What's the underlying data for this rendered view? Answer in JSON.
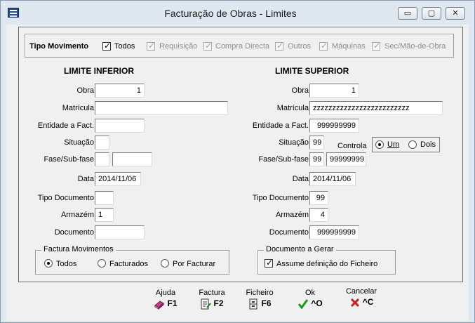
{
  "window": {
    "title": "Facturação de Obras - Limites",
    "controls": {
      "minimize": "▭",
      "restore": "▢",
      "close": "✕"
    }
  },
  "tipo_movimento": {
    "label": "Tipo Movimento",
    "options": [
      {
        "label": "Todos",
        "checked": true,
        "enabled": true
      },
      {
        "label": "Requisição",
        "checked": true,
        "enabled": false
      },
      {
        "label": "Compra Directa",
        "checked": true,
        "enabled": false
      },
      {
        "label": "Outros",
        "checked": true,
        "enabled": false
      },
      {
        "label": "Máquinas",
        "checked": true,
        "enabled": false
      },
      {
        "label": "Sec/Mão-de-Obra",
        "checked": true,
        "enabled": false
      }
    ]
  },
  "limite_inferior": {
    "heading": "LIMITE INFERIOR",
    "obra_label": "Obra",
    "obra_value": "1",
    "matricula_label": "Matrícula",
    "matricula_value": "",
    "entidade_label": "Entidade a Fact.",
    "entidade_value": "",
    "situacao_label": "Situação",
    "situacao_value": "",
    "fase_label": "Fase/Sub-fase",
    "fase_value": "",
    "subfase_value": "",
    "data_label": "Data",
    "data_value": "2014/11/06",
    "tipo_doc_label": "Tipo Documento",
    "tipo_doc_value": "",
    "armazem_label": "Armazém",
    "armazem_value": "1",
    "documento_label": "Documento",
    "documento_value": ""
  },
  "limite_superior": {
    "heading": "LIMITE SUPERIOR",
    "obra_label": "Obra",
    "obra_value": "1",
    "matricula_label": "Matrícula",
    "matricula_value": "zzzzzzzzzzzzzzzzzzzzzzzzz",
    "entidade_label": "Entidade a Fact.",
    "entidade_value": "999999999",
    "situacao_label": "Situação",
    "situacao_value": "99",
    "controla_label": "Controla",
    "controla_options": [
      {
        "label": "Um",
        "selected": true
      },
      {
        "label": "Dois",
        "selected": false
      }
    ],
    "fase_label": "Fase/Sub-fase",
    "fase_value": "99",
    "subfase_value": "99999999",
    "data_label": "Data",
    "data_value": "2014/11/06",
    "tipo_doc_label": "Tipo Documento",
    "tipo_doc_value": "99",
    "armazem_label": "Armazém",
    "armazem_value": "4",
    "documento_label": "Documento",
    "documento_value": "999999999"
  },
  "factura_movimentos": {
    "title": "Factura Movimentos",
    "options": [
      {
        "label": "Todos",
        "selected": true
      },
      {
        "label": "Facturados",
        "selected": false
      },
      {
        "label": "Por Facturar",
        "selected": false
      }
    ]
  },
  "documento_gerar": {
    "title": "Documento a Gerar",
    "checkbox_label": "Assume definição do Ficheiro",
    "checked": true
  },
  "function_keys": [
    {
      "label": "Ajuda",
      "key": "F1",
      "icon": "book-icon"
    },
    {
      "label": "Factura",
      "key": "F2",
      "icon": "invoice-icon"
    },
    {
      "label": "Ficheiro",
      "key": "F6",
      "icon": "file-cabinet-icon"
    },
    {
      "label": "Ok",
      "key": "^O",
      "icon": "checkmark-icon"
    },
    {
      "label": "Cancelar",
      "key": "^C",
      "icon": "cancel-x-icon"
    }
  ],
  "colors": {
    "title_bar": "#dfe8f1",
    "ok_green": "#1a9a1a",
    "cancel_red": "#c42020"
  }
}
